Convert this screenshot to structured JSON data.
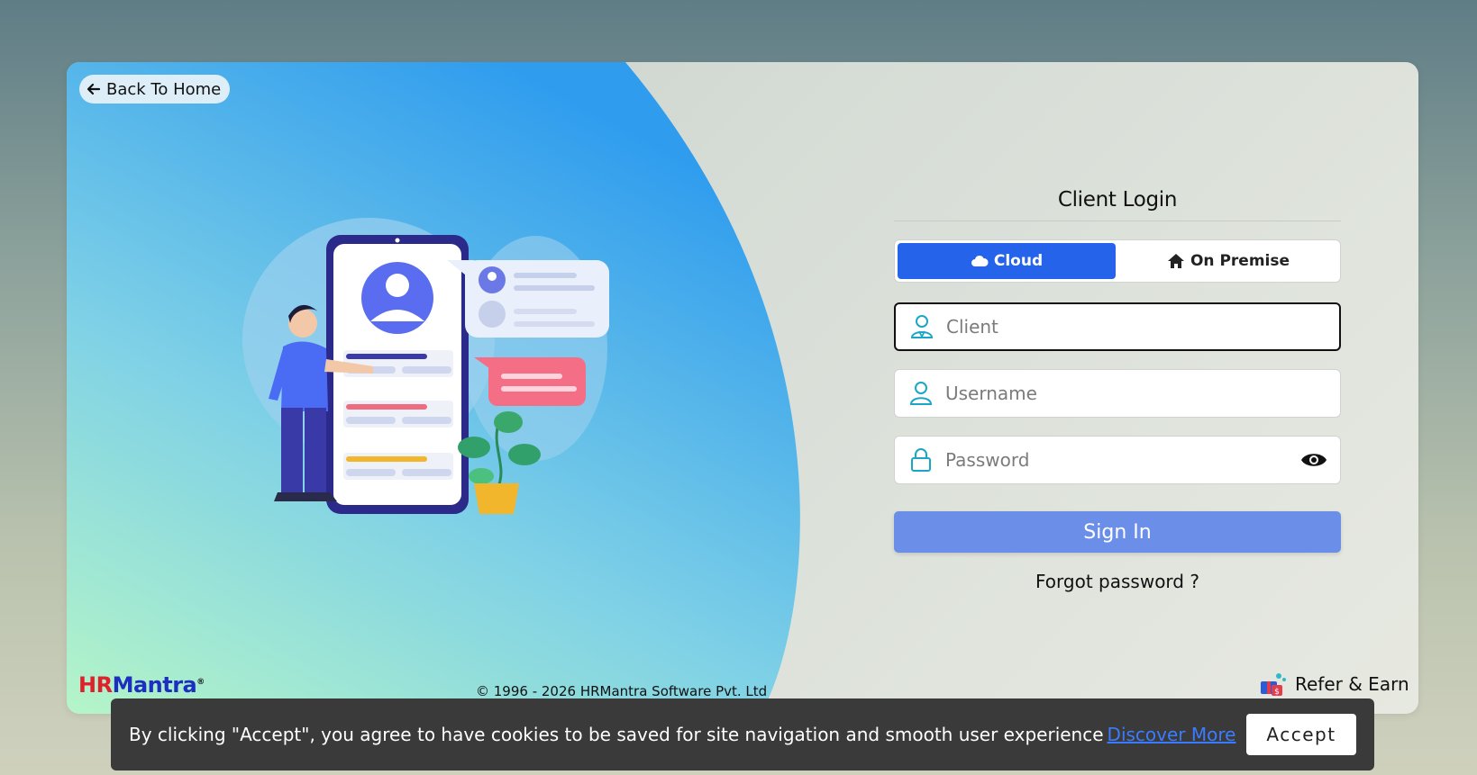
{
  "back": {
    "label": "Back To Home"
  },
  "login": {
    "title": "Client Login",
    "tabs": [
      {
        "label": "Cloud",
        "icon": "cloud-icon",
        "active": true
      },
      {
        "label": "On Premise",
        "icon": "home-icon",
        "active": false
      }
    ],
    "client": {
      "placeholder": "Client",
      "value": ""
    },
    "username": {
      "placeholder": "Username",
      "value": ""
    },
    "password": {
      "placeholder": "Password",
      "value": ""
    },
    "signin_label": "Sign In",
    "forgot_label": "Forgot password ?"
  },
  "footer": {
    "logo_hr": "HR",
    "logo_mantra": "Mantra",
    "logo_reg": "®",
    "copyright": "© 1996 - 2026 HRMantra Software Pvt. Ltd",
    "refer_label": "Refer & Earn"
  },
  "cookie": {
    "message": "By clicking \"Accept\", you agree to have cookies to be saved for site navigation and smooth user experience",
    "more_label": "Discover More",
    "accept_label": "Accept"
  },
  "colors": {
    "accent": "#2563eb",
    "signin": "#6b8fe8",
    "icon": "#1aa7c7"
  }
}
